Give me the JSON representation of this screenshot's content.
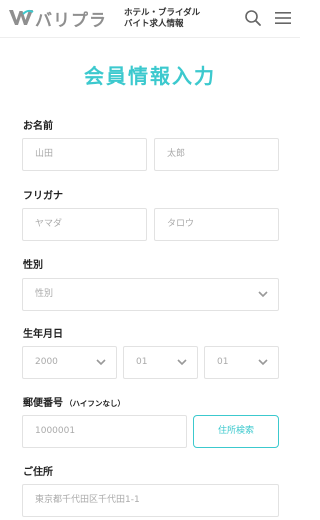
{
  "header": {
    "logo_text": "バリプラ",
    "tagline_line1": "ホテル・ブライダル",
    "tagline_line2": "バイト求人情報"
  },
  "page_title": "会員情報入力",
  "form": {
    "name": {
      "label": "お名前",
      "last_placeholder": "山田",
      "first_placeholder": "太郎"
    },
    "furigana": {
      "label": "フリガナ",
      "last_placeholder": "ヤマダ",
      "first_placeholder": "タロウ"
    },
    "gender": {
      "label": "性別",
      "selected": "性別"
    },
    "birthdate": {
      "label": "生年月日",
      "year": "2000",
      "month": "01",
      "day": "01"
    },
    "postal": {
      "label": "郵便番号",
      "note": "（ハイフンなし）",
      "placeholder": "1000001",
      "button_label": "住所検索"
    },
    "address": {
      "label": "ご住所",
      "placeholder": "東京都千代田区千代田1-1"
    }
  },
  "colors": {
    "accent": "#3cc9ce",
    "border": "#e2e2e2",
    "placeholder": "#aaaaaa"
  },
  "icons": [
    "logo-mark-icon",
    "search-icon",
    "hamburger-menu-icon",
    "chevron-down-icon"
  ]
}
